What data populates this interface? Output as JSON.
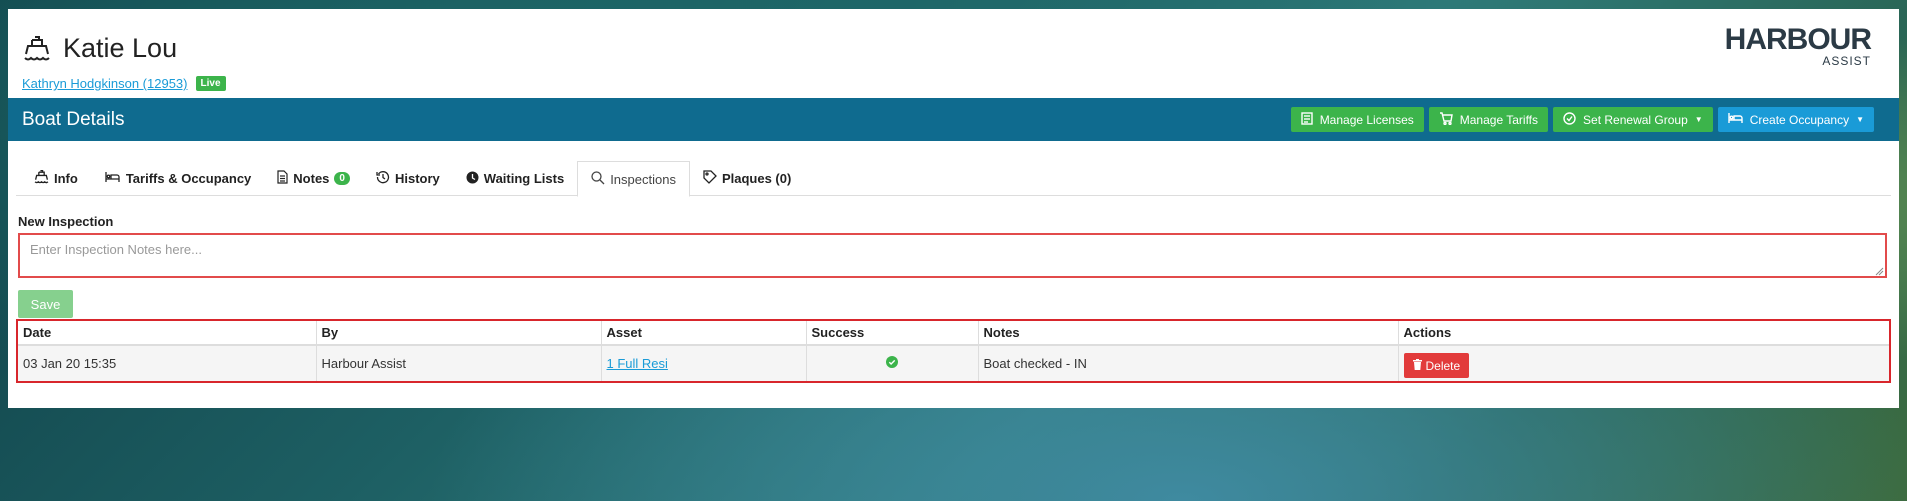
{
  "header": {
    "boat_name": "Katie Lou",
    "owner_link": "Kathryn Hodgkinson (12953)",
    "status_badge": "Live",
    "logo_main": "HARBOUR",
    "logo_sub": "ASSIST"
  },
  "panel": {
    "title": "Boat Details",
    "buttons": {
      "manage_licenses": "Manage Licenses",
      "manage_tariffs": "Manage Tariffs",
      "set_renewal_group": "Set Renewal Group",
      "create_occupancy": "Create Occupancy"
    }
  },
  "tabs": {
    "info": "Info",
    "tariffs": "Tariffs & Occupancy",
    "notes": "Notes",
    "notes_count": "0",
    "history": "History",
    "waiting_lists": "Waiting Lists",
    "inspections": "Inspections",
    "plaques": "Plaques (0)"
  },
  "inspection_form": {
    "label": "New Inspection",
    "placeholder": "Enter Inspection Notes here...",
    "save_label": "Save"
  },
  "table": {
    "columns": [
      "Date",
      "By",
      "Asset",
      "Success",
      "Notes",
      "Actions"
    ],
    "rows": [
      {
        "date": "03 Jan 20 15:35",
        "by": "Harbour Assist",
        "asset": "1 Full Resi",
        "success": true,
        "notes": "Boat checked - IN",
        "action": "Delete"
      }
    ]
  },
  "colors": {
    "header_bar": "#0f6b8f",
    "green": "#3cb44b",
    "blue": "#1a9bd7",
    "danger": "#e23b3b"
  }
}
